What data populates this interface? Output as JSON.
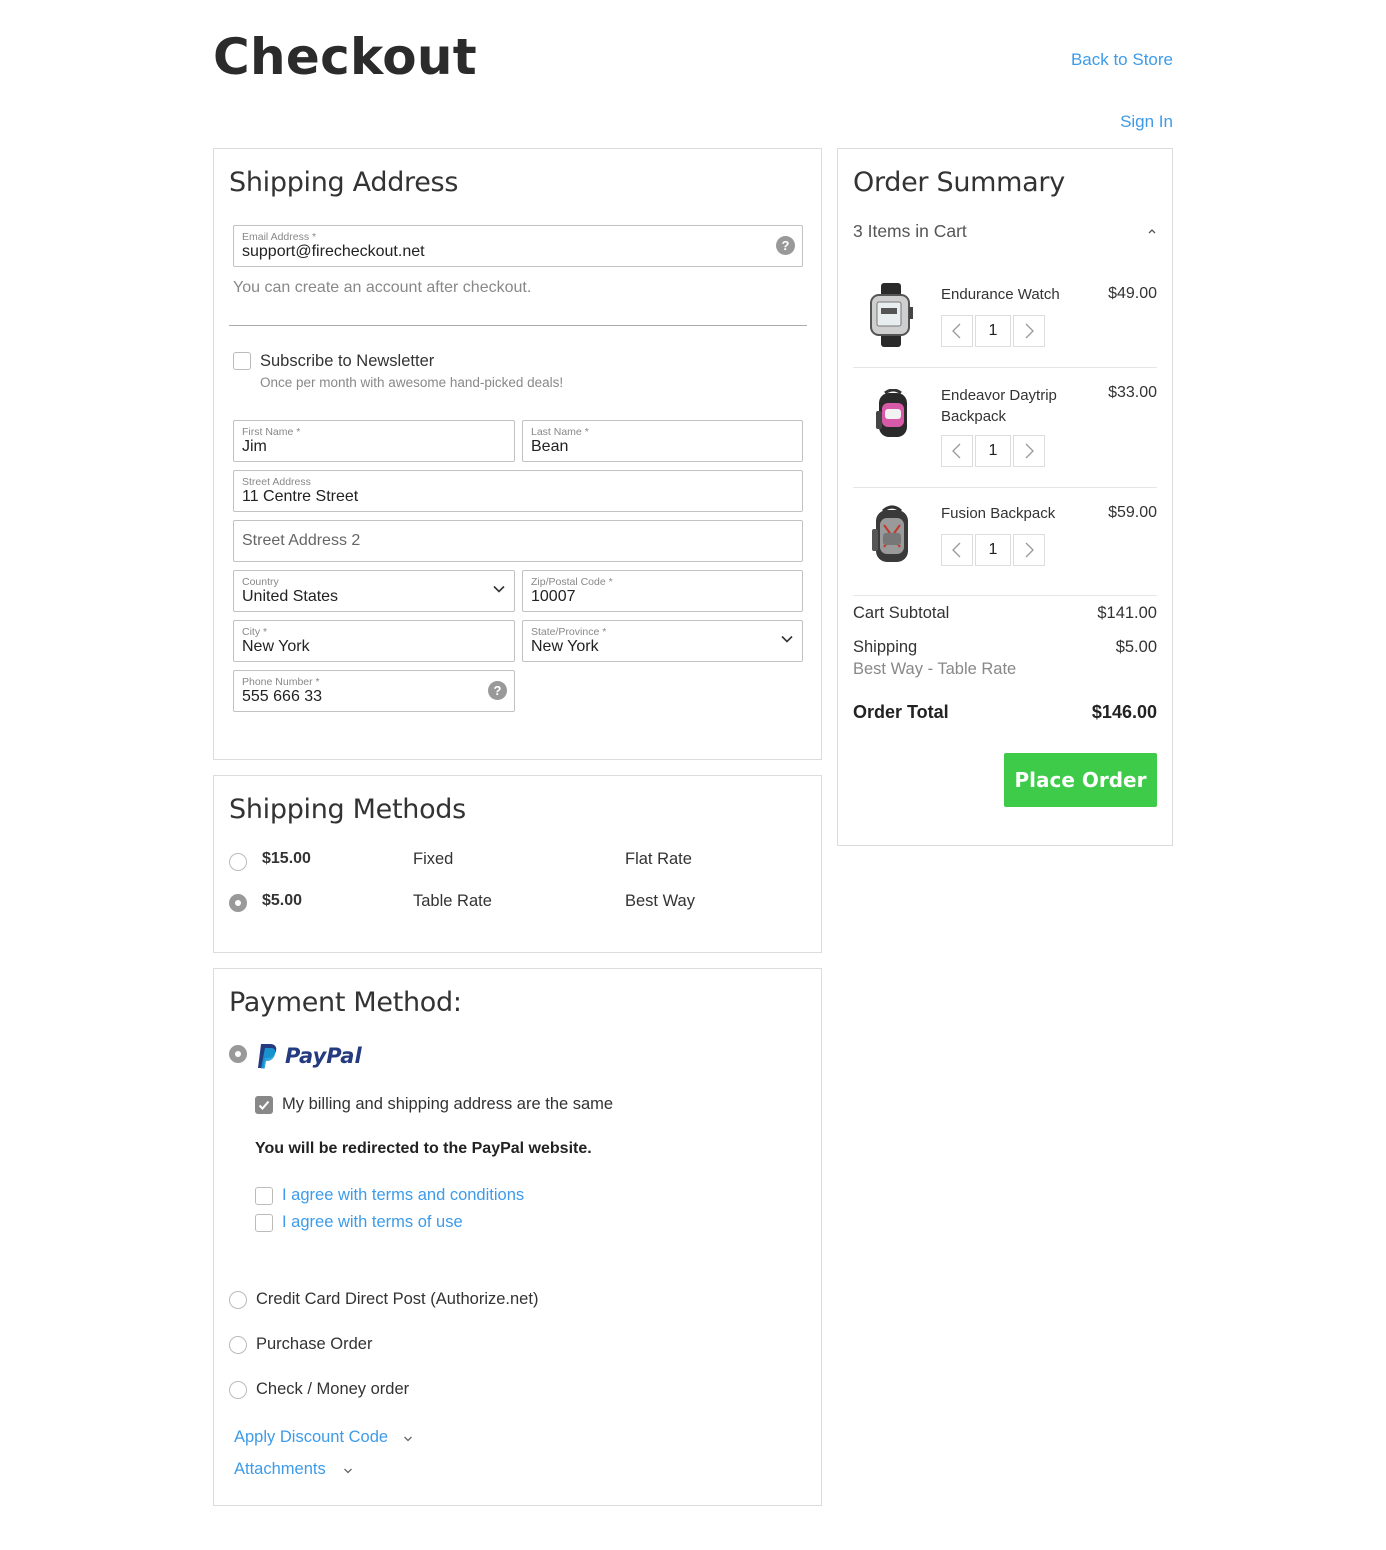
{
  "header": {
    "title": "Checkout",
    "back_to_store": "Back to Store",
    "sign_in": "Sign In"
  },
  "shipping_address": {
    "title": "Shipping Address",
    "email": {
      "label": "Email Address *",
      "value": "support@firecheckout.net"
    },
    "email_note": "You can create an account after checkout.",
    "newsletter": {
      "label": "Subscribe to Newsletter",
      "note": "Once per month with awesome hand-picked deals!",
      "checked": false
    },
    "first_name": {
      "label": "First Name *",
      "value": "Jim"
    },
    "last_name": {
      "label": "Last Name *",
      "value": "Bean"
    },
    "street": {
      "label": "Street Address",
      "value": "11 Centre Street"
    },
    "street2": {
      "placeholder": "Street Address 2"
    },
    "country": {
      "label": "Country",
      "value": "United States"
    },
    "zip": {
      "label": "Zip/Postal Code *",
      "value": "10007"
    },
    "city": {
      "label": "City *",
      "value": "New York"
    },
    "state": {
      "label": "State/Province *",
      "value": "New York"
    },
    "phone": {
      "label": "Phone Number *",
      "value": "555 666 33"
    }
  },
  "shipping_methods": {
    "title": "Shipping Methods",
    "options": [
      {
        "price": "$15.00",
        "method": "Fixed",
        "carrier": "Flat Rate",
        "selected": false
      },
      {
        "price": "$5.00",
        "method": "Table Rate",
        "carrier": "Best Way",
        "selected": true
      }
    ]
  },
  "payment": {
    "title": "Payment Method:",
    "paypal": {
      "logo_text": "PayPal",
      "billing_same": "My billing and shipping address are the same",
      "redirect_note": "You will be redirected to the PayPal website.",
      "terms1": "I agree with terms and conditions",
      "terms2": "I agree with terms of use"
    },
    "other_methods": [
      "Credit Card Direct Post (Authorize.net)",
      "Purchase Order",
      "Check / Money order"
    ],
    "discount_link": "Apply Discount Code",
    "attachments_link": "Attachments"
  },
  "order_summary": {
    "title": "Order Summary",
    "items_count_label": "3 Items in Cart",
    "items": [
      {
        "name": "Endurance Watch",
        "price": "$49.00",
        "qty": "1",
        "icon": "watch-image"
      },
      {
        "name": "Endeavor Daytrip Backpack",
        "price": "$33.00",
        "qty": "1",
        "icon": "backpack-pink-image"
      },
      {
        "name": "Fusion Backpack",
        "price": "$59.00",
        "qty": "1",
        "icon": "backpack-gray-image"
      }
    ],
    "subtotal_label": "Cart Subtotal",
    "subtotal_value": "$141.00",
    "shipping_label": "Shipping",
    "shipping_value": "$5.00",
    "shipping_method": "Best Way - Table Rate",
    "total_label": "Order Total",
    "total_value": "$146.00",
    "place_order": "Place Order"
  },
  "colors": {
    "link": "#3d9be9",
    "place_order_bg": "#3ecb4a",
    "border": "#dcdcdc"
  }
}
